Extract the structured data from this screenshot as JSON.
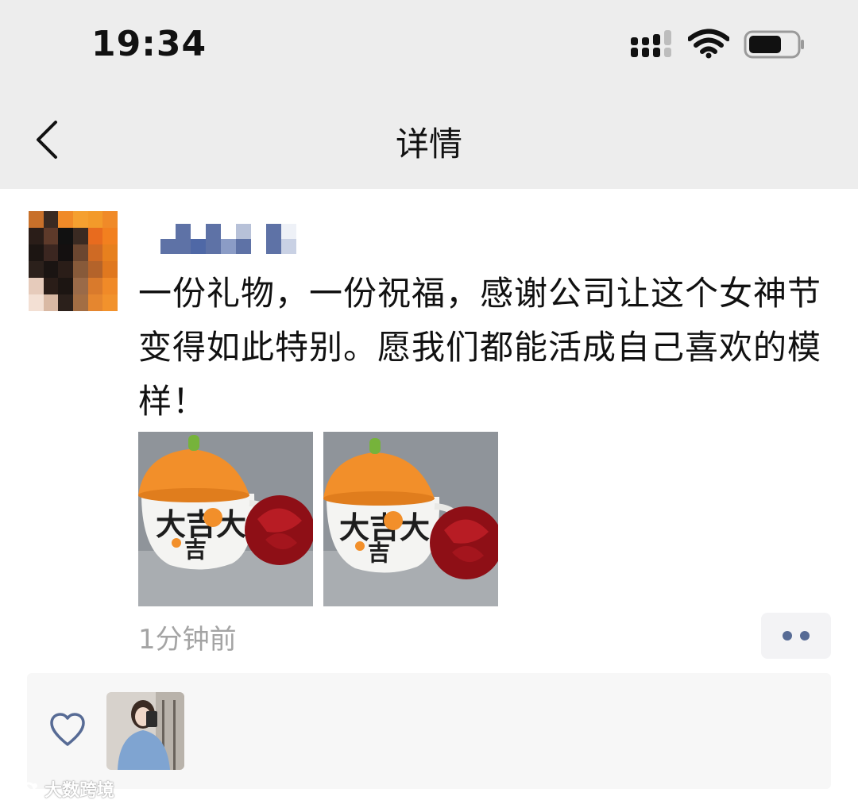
{
  "status_bar": {
    "time": "19:34"
  },
  "nav": {
    "title": "详情"
  },
  "post": {
    "text": "一份礼物，一份祝福，感谢公司让这个女神节变得如此特别。愿我们都能活成自己喜欢的模样！",
    "timestamp": "1分钟前",
    "photo_mug_text_main": "大吉大",
    "photo_mug_text_second": "吉"
  },
  "watermark": {
    "text": "大数跨境"
  },
  "colors": {
    "header_bg": "#ededed",
    "link_blue": "#576b95",
    "time_gray": "#a4a4a4",
    "panel_bg": "#f7f7f7"
  }
}
